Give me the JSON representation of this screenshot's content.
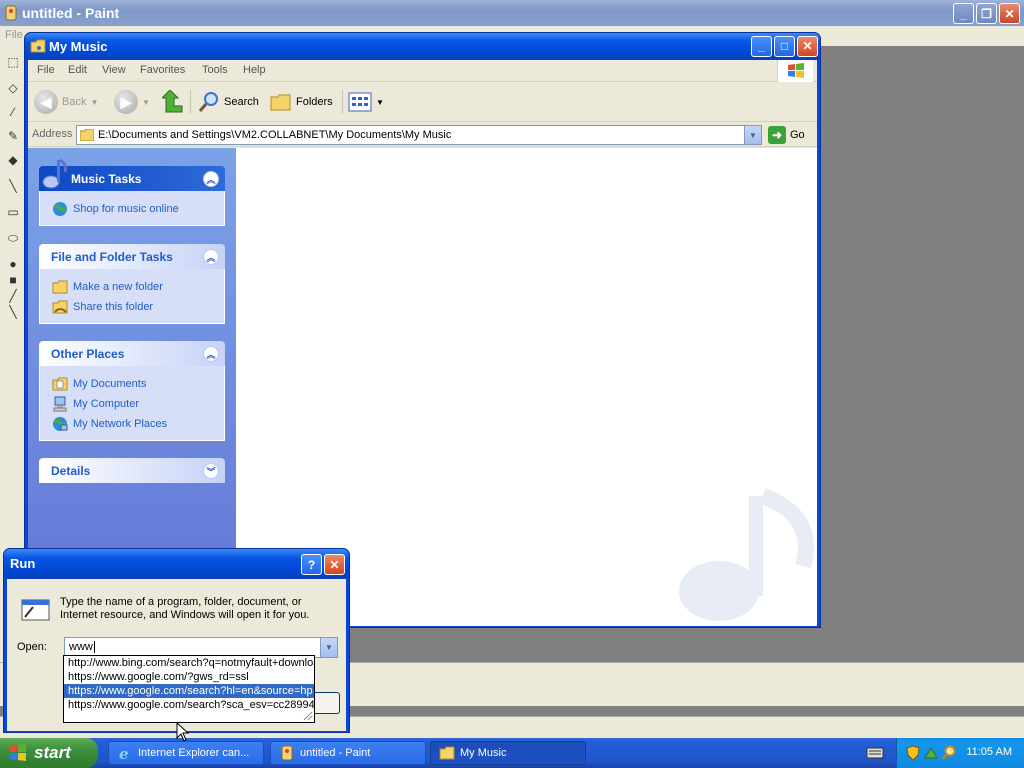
{
  "paint": {
    "title": "untitled - Paint",
    "menu_partial": "File"
  },
  "explorer": {
    "title": "My Music",
    "menu": [
      "File",
      "Edit",
      "View",
      "Favorites",
      "Tools",
      "Help"
    ],
    "toolbar": {
      "back": "Back",
      "search": "Search",
      "folders": "Folders"
    },
    "address_label": "Address",
    "address_value": "E:\\Documents and Settings\\VM2.COLLABNET\\My Documents\\My Music",
    "go_label": "Go",
    "panels": {
      "music_tasks": {
        "title": "Music Tasks",
        "items": [
          "Shop for music online"
        ]
      },
      "file_folder_tasks": {
        "title": "File and Folder Tasks",
        "items": [
          "Make a new folder",
          "Share this folder"
        ]
      },
      "other_places": {
        "title": "Other Places",
        "items": [
          "My Documents",
          "My Computer",
          "My Network Places"
        ]
      },
      "details": {
        "title": "Details"
      }
    }
  },
  "run": {
    "title": "Run",
    "description": "Type the name of a program, folder, document, or Internet resource, and Windows will open it for you.",
    "open_label": "Open:",
    "open_value": "www",
    "suggestions": [
      "http://www.bing.com/search?q=notmyfault+download",
      "https://www.google.com/?gws_rd=ssl",
      "https://www.google.com/search?hl=en&source=hp",
      "https://www.google.com/search?sca_esv=cc28994"
    ],
    "selected_index": 2
  },
  "taskbar": {
    "start": "start",
    "tasks": [
      "Internet Explorer can...",
      "untitled - Paint",
      "My Music"
    ],
    "clock": "11:05 AM"
  },
  "colors": {
    "xp_blue": "#0a46d8",
    "task_link": "#215dc6",
    "selection": "#316ac5",
    "start_green": "#3c8f3c"
  }
}
